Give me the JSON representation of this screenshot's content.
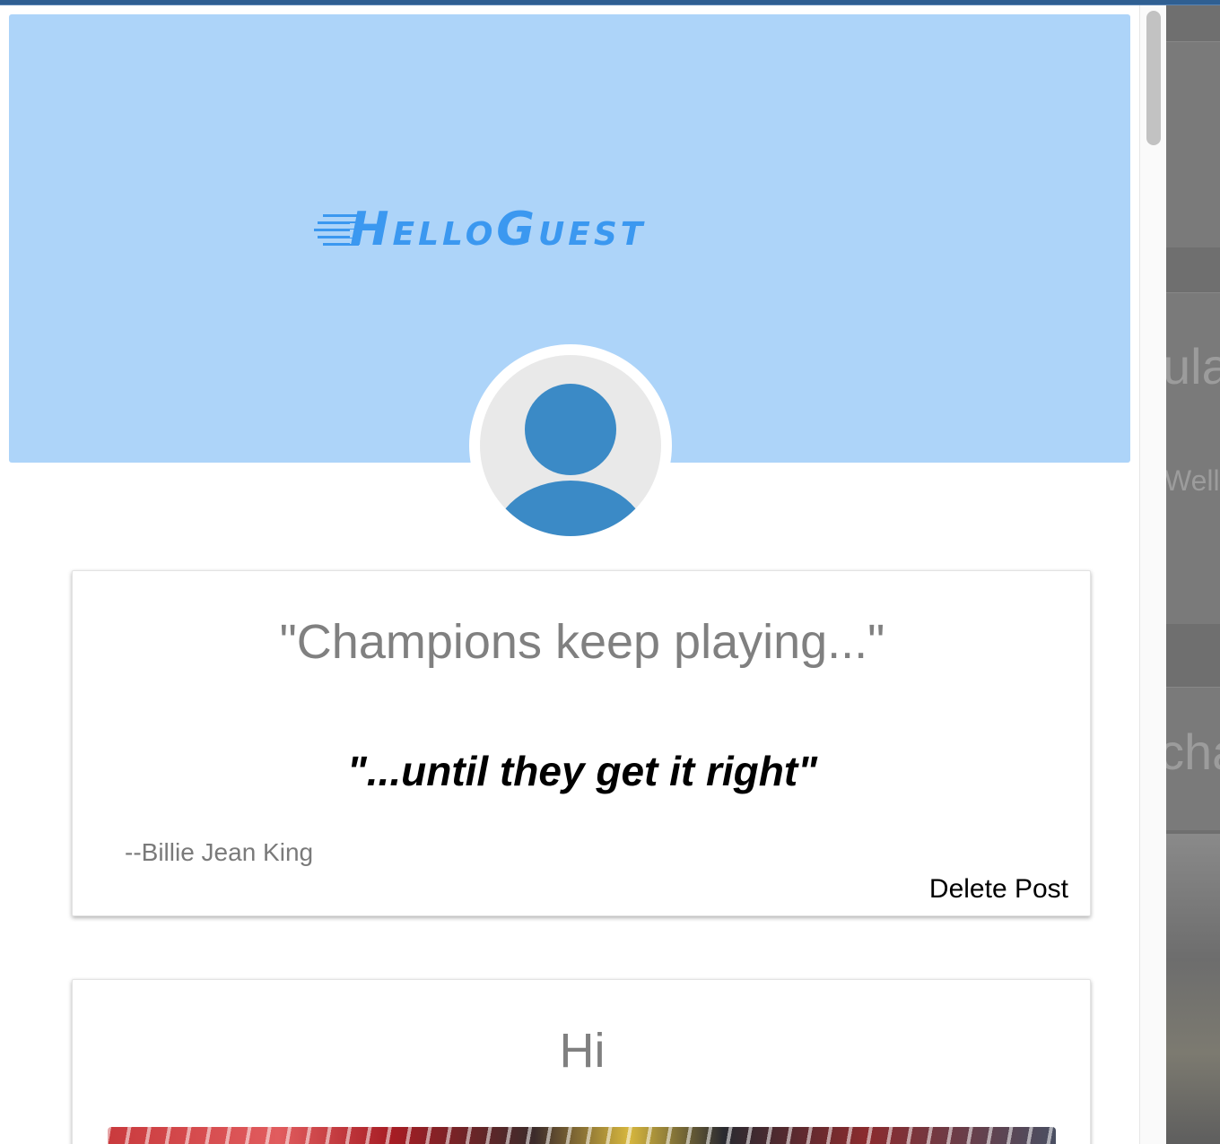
{
  "window": {
    "accent_color": "#2f5f92"
  },
  "background_page": {
    "fragments": [
      "ula",
      "Well",
      "cha"
    ]
  },
  "header": {
    "banner_color": "#add4f9",
    "logo_text": "HelloGuest",
    "logo_color": "#3b98f0",
    "avatar_icon": "user-silhouette-icon"
  },
  "posts": [
    {
      "title": "\"Champions keep playing...\"",
      "quote": "\"...until they get it right\"",
      "author": "--Billie Jean King",
      "delete_label": "Delete Post"
    },
    {
      "title": "Hi",
      "has_image": true
    }
  ]
}
